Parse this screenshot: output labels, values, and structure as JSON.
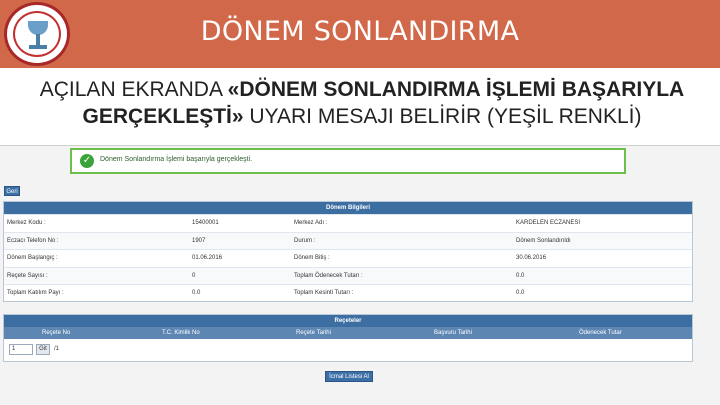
{
  "header": {
    "title": "DÖNEM SONLANDIRMA",
    "logo_name": "pharmacy-logo"
  },
  "bullet": {
    "prefix": "AÇILAN EKRANDA ",
    "strong": "«DÖNEM SONLANDIRMA İŞLEMİ BAŞARIYLA GERÇEKLEŞTİ»",
    "suffix": " UYARI MESAJI BELİRİR (YEŞİL RENKLİ)"
  },
  "screen": {
    "success_message": "Dönem Sonlandırma İşlemi başarıyla gerçekleşti.",
    "back_button": "Geri",
    "info_panel": {
      "title": "Dönem Bilgileri",
      "rows": [
        {
          "l1": "Merkez Kodu :",
          "v1": "15400001",
          "l2": "Merkez Adı :",
          "v2": "KARDELEN ECZANESI"
        },
        {
          "l1": "Eczacı Telefon No :",
          "v1": "1907",
          "l2": "Durum :",
          "v2": "Dönem Sonlandırıldı"
        },
        {
          "l1": "Dönem Başlangıç :",
          "v1": "01.06.2016",
          "l2": "Dönem Bitiş :",
          "v2": "30.06.2016"
        },
        {
          "l1": "Reçete Sayısı :",
          "v1": "0",
          "l2": "Toplam Ödenecek Tutarı :",
          "v2": "0.0"
        },
        {
          "l1": "Toplam Katılım Payı :",
          "v1": "0.0",
          "l2": "Toplam Kesinti Tutarı :",
          "v2": "0.0"
        }
      ]
    },
    "prescription_panel": {
      "title": "Reçeteler",
      "columns": [
        "Reçete No",
        "T.C. Kimlik No",
        "Reçete Tarihi",
        "Başvuru Tarihi",
        "Ödenecek Tutar"
      ],
      "page_value": "1",
      "go_label": "Git",
      "page_total": "/1"
    },
    "print_button": "İcmal Listesi Al"
  }
}
